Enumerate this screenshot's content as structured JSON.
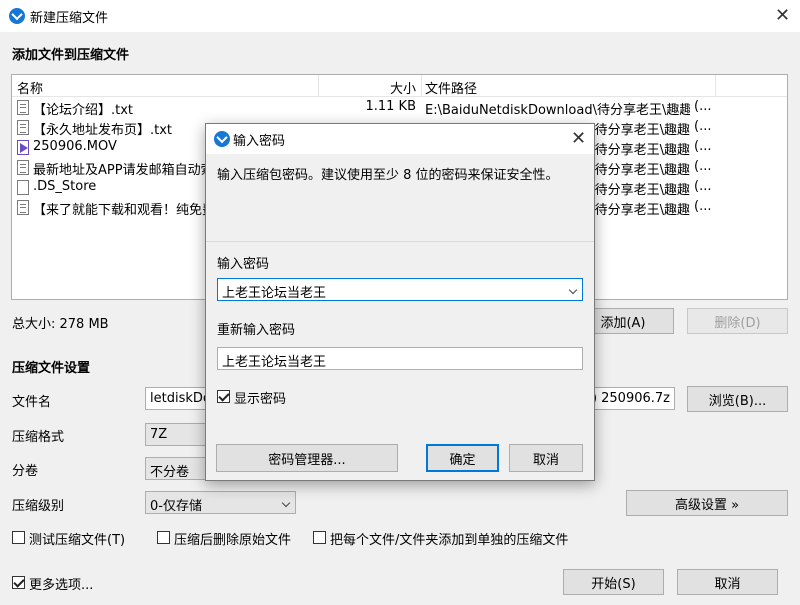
{
  "window": {
    "title": "新建压缩文件",
    "close_glyph": "✕"
  },
  "add_section": {
    "title": "添加文件到压缩文件"
  },
  "file_list": {
    "columns": [
      "名称",
      "大小",
      "文件路径"
    ],
    "rows": [
      {
        "icon": "text-file-icon",
        "name": "【论坛介绍】.txt",
        "size": "1.11 KB",
        "path": "E:\\BaiduNetdiskDownload\\待分享老王\\趣趣",
        "more": "(..."
      },
      {
        "icon": "text-file-icon",
        "name": "【永久地址发布页】.txt",
        "size": "",
        "path": "待分享老王\\趣趣",
        "more": "(..."
      },
      {
        "icon": "video-file-icon",
        "name": "250906.MOV",
        "size": "",
        "path": "待分享老王\\趣趣",
        "more": "(..."
      },
      {
        "icon": "text-file-icon",
        "name": "最新地址及APP请发邮箱自动索",
        "size": "",
        "path": "待分享老王\\趣趣",
        "more": "(..."
      },
      {
        "icon": "blank-file-icon",
        "name": ".DS_Store",
        "size": "",
        "path": "待分享老王\\趣趣",
        "more": "(..."
      },
      {
        "icon": "text-file-icon",
        "name": "【来了就能下载和观看！纯免费",
        "size": "",
        "path": "待分享老王\\趣趣",
        "more": "(..."
      }
    ]
  },
  "total_size": "总大小: 278 MB",
  "buttons": {
    "add": "添加(A)",
    "remove": "删除(D)",
    "browse": "浏览(B)...",
    "advanced": "高级设置 »",
    "start": "开始(S)",
    "cancel": "取消"
  },
  "settings": {
    "title": "压缩文件设置",
    "filename_label": "文件名",
    "filename_left": "letdiskDo",
    "filename_right": ") 250906.7z",
    "format_label": "压缩格式",
    "format_value": "7Z",
    "split_label": "分卷",
    "split_value": "不分卷",
    "level_label": "压缩级别",
    "level_value": "0-仅存储"
  },
  "options": {
    "test_archive": "测试压缩文件(T)",
    "delete_after": "压缩后删除原始文件",
    "separate_archives": "把每个文件/文件夹添加到单独的压缩文件",
    "more_options": "更多选项..."
  },
  "dialog": {
    "title": "输入密码",
    "description": "输入压缩包密码。建议使用至少 8 位的密码来保证安全性。",
    "password_label": "输入密码",
    "password_value": "上老王论坛当老王",
    "repeat_label": "重新输入密码",
    "repeat_value": "上老王论坛当老王",
    "show_password": "显示密码",
    "show_password_checked": true,
    "manager_button": "密码管理器...",
    "ok_button": "确定",
    "cancel_button": "取消"
  },
  "colors": {
    "accent": "#0078d7",
    "app_icon": "#1677d6"
  }
}
